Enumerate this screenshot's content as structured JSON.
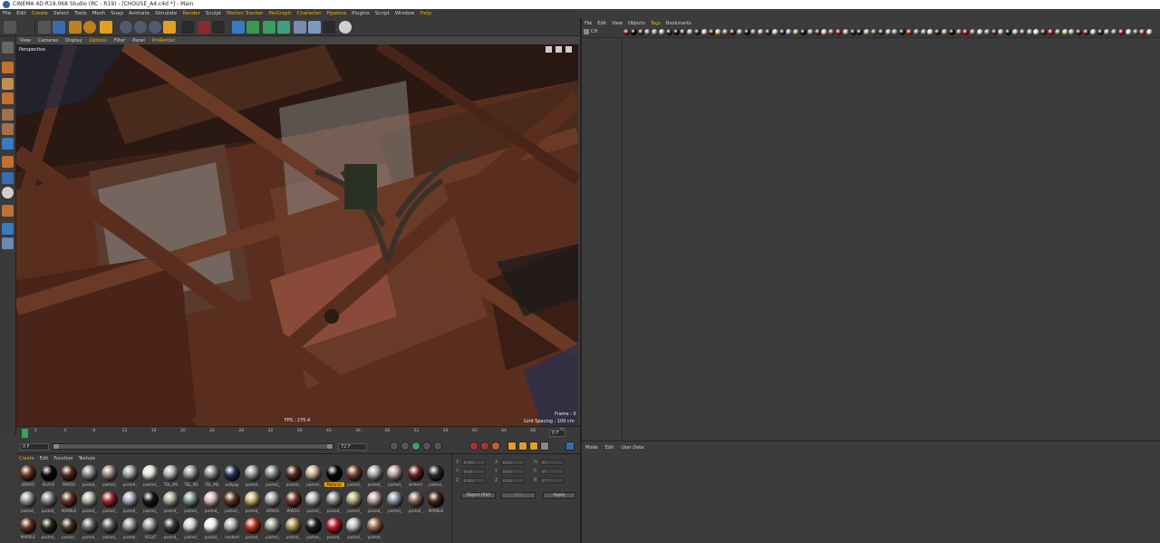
{
  "window": {
    "title": "CINEMA 4D R19.068 Studio (RC - R19) - [CHOUSE_A4.c4d *] - Main"
  },
  "menu": [
    "File",
    "Edit",
    "Create",
    "Select",
    "Tools",
    "Mesh",
    "Snap",
    "Animate",
    "Simulate",
    "Render",
    "Sculpt",
    "Motion Tracker",
    "MoGraph",
    "Character",
    "Pipeline",
    "Plugins",
    "Script",
    "Window",
    "Help"
  ],
  "viewport": {
    "menu": [
      "View",
      "Cameras",
      "Display",
      "Options",
      "Filter",
      "Panel",
      "ProRender"
    ],
    "label": "Perspective",
    "fps": "FPS : 275.4",
    "frame": "Frame : 0",
    "grid_spacing": "Grid Spacing : 100 cm"
  },
  "timeline": {
    "ticks": [
      "0",
      "4",
      "8",
      "12",
      "16",
      "20",
      "24",
      "28",
      "32",
      "36",
      "40",
      "44",
      "48",
      "52",
      "56",
      "60",
      "64",
      "68",
      "72"
    ],
    "start": "0 F",
    "start2": "0 F",
    "end": "72 F",
    "end2": "72 F",
    "slider_value": "72 F",
    "frame_field": "0 F"
  },
  "material_manager": {
    "menu": [
      "Create",
      "Edit",
      "Function",
      "Texture"
    ],
    "materials": [
      {
        "name": "WWOO",
        "color": "#6a3a26"
      },
      {
        "name": "BLACK",
        "color": "#0c0c0c"
      },
      {
        "name": "WWOO",
        "color": "#5a2e1e"
      },
      {
        "name": "pasted_",
        "color": "#8a8a8a"
      },
      {
        "name": "pasted_",
        "color": "#9a8a80"
      },
      {
        "name": "pasted_",
        "color": "#a0a0a0"
      },
      {
        "name": "pasted_",
        "color": "#e8e8e0"
      },
      {
        "name": "TBL_MS",
        "color": "#b0b0b0"
      },
      {
        "name": "TBL_MS",
        "color": "#9a9a9a"
      },
      {
        "name": "TBL_MS",
        "color": "#8c8c8c"
      },
      {
        "name": "wallpap",
        "color": "#2a3a5a"
      },
      {
        "name": "pasted_",
        "color": "#999999"
      },
      {
        "name": "pasted_",
        "color": "#888888"
      },
      {
        "name": "pasted_",
        "color": "#5a3020"
      },
      {
        "name": "pasted_",
        "color": "#c8b090"
      },
      {
        "name": "Material",
        "color": "#0a0a0a"
      },
      {
        "name": "pasted_",
        "color": "#7a4a30"
      },
      {
        "name": "pasted_",
        "color": "#aaaaaa"
      },
      {
        "name": "pasted_",
        "color": "#b8a0a0"
      },
      {
        "name": "lambert",
        "color": "#6a2a1e"
      },
      {
        "name": "pasted_",
        "color": "#303030"
      },
      {
        "name": "pasted_",
        "color": "#9a9a9a"
      },
      {
        "name": "pasted_",
        "color": "#888"
      },
      {
        "name": "MARBLE",
        "color": "#6a3a28"
      },
      {
        "name": "pasted_",
        "color": "#b0b8a8"
      },
      {
        "name": "pasted_",
        "color": "#a03030"
      },
      {
        "name": "pasted_",
        "color": "#a0a8b8"
      },
      {
        "name": "pasted_",
        "color": "#1a1a1a"
      },
      {
        "name": "pasted_",
        "color": "#a8a890"
      },
      {
        "name": "pasted_",
        "color": "#7a9a88"
      },
      {
        "name": "pasted_",
        "color": "#d8b8b8"
      },
      {
        "name": "pasted_",
        "color": "#6a3a28"
      },
      {
        "name": "pasted_",
        "color": "#c8b070"
      },
      {
        "name": "WWOO",
        "color": "#a0a0a0"
      },
      {
        "name": "WWOO",
        "color": "#7a3a28"
      },
      {
        "name": "pasted_",
        "color": "#b0b0b0"
      },
      {
        "name": "pasted_",
        "color": "#909090"
      },
      {
        "name": "pasted_",
        "color": "#b0a878"
      },
      {
        "name": "pasted_",
        "color": "#c0a0a0"
      },
      {
        "name": "pasted_",
        "color": "#8898a8"
      },
      {
        "name": "pasted_",
        "color": "#8a6a58"
      },
      {
        "name": "MARBLE",
        "color": "#4a2a1a"
      },
      {
        "name": "MARBLE",
        "color": "#6a3a28"
      },
      {
        "name": "pasted_",
        "color": "#2a2a20"
      },
      {
        "name": "pasted_",
        "color": "#4a3a28"
      },
      {
        "name": "pasted_",
        "color": "#707070"
      },
      {
        "name": "pasted_",
        "color": "#606060"
      },
      {
        "name": "pasted_",
        "color": "#909890"
      },
      {
        "name": "VEGAT",
        "color": "#9a9a9a"
      },
      {
        "name": "pasted_",
        "color": "#404040"
      },
      {
        "name": "pasted_",
        "color": "#d0d0d0"
      },
      {
        "name": "pasted_",
        "color": "#f0f0f0"
      },
      {
        "name": "lambert",
        "color": "#b0b0b0"
      },
      {
        "name": "pasted_",
        "color": "#c03a20"
      },
      {
        "name": "pasted_",
        "color": "#a0a090"
      },
      {
        "name": "pasted_",
        "color": "#a89050"
      },
      {
        "name": "pasted_",
        "color": "#202020"
      },
      {
        "name": "pasted_",
        "color": "#c02030"
      },
      {
        "name": "pasted_",
        "color": "#c0c0c0"
      },
      {
        "name": "pasted_",
        "color": "#a07050"
      }
    ]
  },
  "coords": {
    "rows": [
      {
        "axis": "X",
        "pos": "0 cm",
        "s": "X",
        "size": "0 cm",
        "h": "H",
        "rot": "0°"
      },
      {
        "axis": "Y",
        "pos": "0 cm",
        "s": "Y",
        "size": "0 cm",
        "h": "P",
        "rot": "0°"
      },
      {
        "axis": "Z",
        "pos": "0 cm",
        "s": "Z",
        "size": "0 cm",
        "h": "B",
        "rot": "0°"
      }
    ],
    "mode": "Object (Rel)",
    "size_mode": "Size",
    "apply": "Apply"
  },
  "object_manager": {
    "menu": [
      "File",
      "Edit",
      "View",
      "Objects",
      "Tags",
      "Bookmarks"
    ],
    "row_label": "CH",
    "tags": [
      "#8a3020",
      "#0a0a0a",
      "#6a3a28",
      "#909090",
      "#a0a0a0",
      "#c0c0c0",
      "#303030",
      "#1a1a1a",
      "#7a4a30",
      "#b0b0b0",
      "#2a3a5a",
      "#d0d0d0",
      "#5a2e1e",
      "#e0c080",
      "#8a8a8a",
      "#6a3020",
      "#a0a0a0",
      "#1a1a1a",
      "#808080",
      "#b8a0a0",
      "#702a20",
      "#cccccc",
      "#3a3a3a",
      "#a0a8b8",
      "#c0a070",
      "#222222",
      "#9a9a9a",
      "#7a3a28",
      "#d8d8d8",
      "#8a6a58",
      "#a03030",
      "#b0b0b0",
      "#4a2a1a",
      "#303030",
      "#c8b090",
      "#707070",
      "#6a3a28",
      "#aaaaaa",
      "#a0a090",
      "#202020",
      "#c03a20",
      "#909090",
      "#8898a8",
      "#e0e0e0",
      "#5a3020",
      "#b0a878",
      "#181818",
      "#a07050",
      "#c02030",
      "#888888",
      "#d0d0d0",
      "#7a9a88",
      "#6a3a28",
      "#b8b8b8",
      "#2a2a2a",
      "#c0c0c0",
      "#9a6040",
      "#a0a0a0",
      "#f0f0f0",
      "#404040",
      "#c03020",
      "#8a8a8a",
      "#e0c080",
      "#b0b0b0",
      "#4a3a28",
      "#a02828",
      "#d0d0d0",
      "#303030",
      "#a8a890",
      "#888888",
      "#c02030",
      "#e0e0e0",
      "#707070",
      "#c06040",
      "#d8d8d8"
    ]
  },
  "attribute_manager": {
    "menu": [
      "Mode",
      "Edit",
      "User Data"
    ]
  }
}
